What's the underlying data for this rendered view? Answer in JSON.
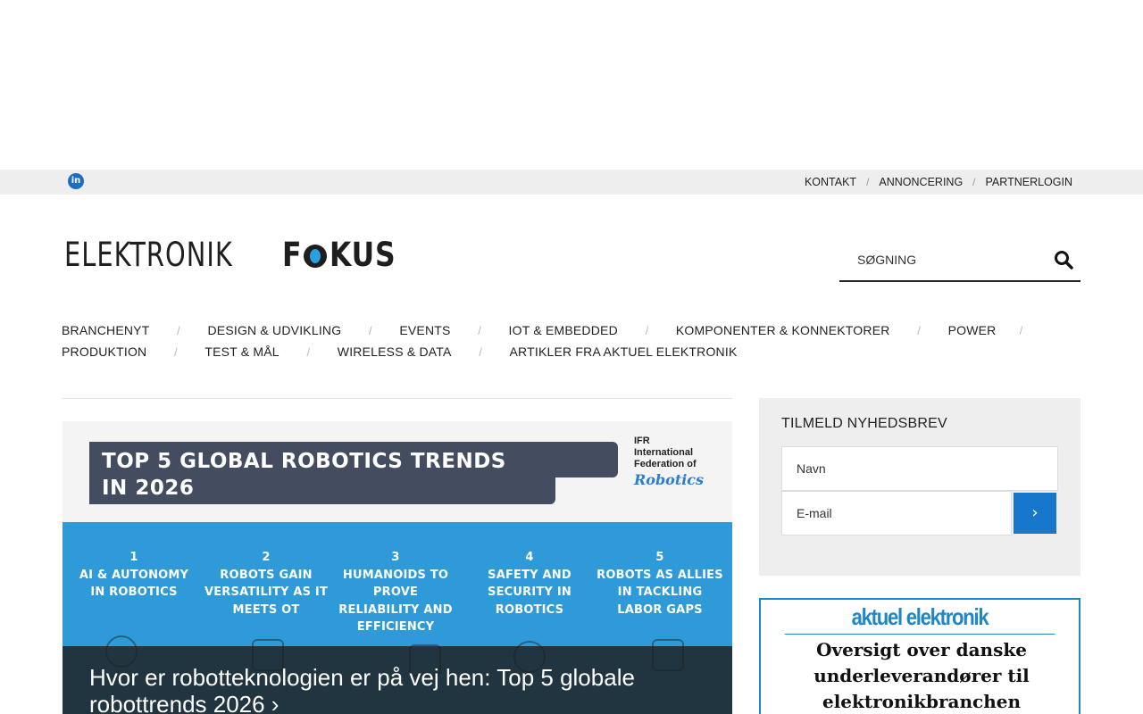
{
  "topbar": {
    "social_icon": "linkedin-icon",
    "social_label": "in",
    "links": [
      "KONTAKT",
      "ANNONCERING",
      "PARTNERLOGIN"
    ],
    "separator": "/"
  },
  "logo": {
    "part1": "ELEKTRONIK",
    "part2_prefix": "F",
    "part2_suffix": "KUS"
  },
  "search": {
    "placeholder": "SØGNING",
    "icon": "search-icon"
  },
  "nav": {
    "row1": [
      "BRANCHENYT",
      "DESIGN & UDVIKLING",
      "EVENTS",
      "IOT & EMBEDDED",
      "KOMPONENTER & KONNEKTORER",
      "POWER"
    ],
    "row2": [
      "PRODUKTION",
      "TEST & MÅL",
      "WIRELESS & DATA",
      "ARTIKLER FRA AKTUEL ELEKTRONIK"
    ],
    "separator": "/"
  },
  "hero": {
    "banner_title_line1": "TOP 5 GLOBAL ROBOTICS TRENDS",
    "banner_title_line2": "IN 2026",
    "ifr_line1": "IFR",
    "ifr_line2": "International",
    "ifr_line3": "Federation of",
    "ifr_line4": "Robotics",
    "trends": [
      {
        "num": "1",
        "line1": "AI & AUTONOMY",
        "line2": "IN ROBOTICS",
        "line3": "",
        "line4": ""
      },
      {
        "num": "2",
        "line1": "ROBOTS GAIN",
        "line2": "VERSATILITY AS IT",
        "line3": "MEETS OT",
        "line4": ""
      },
      {
        "num": "3",
        "line1": "HUMANOIDS TO",
        "line2": "PROVE",
        "line3": "RELIABILITY AND",
        "line4": "EFFICIENCY"
      },
      {
        "num": "4",
        "line1": "SAFETY AND",
        "line2": "SECURITY IN",
        "line3": "ROBOTICS",
        "line4": ""
      },
      {
        "num": "5",
        "line1": "ROBOTS AS ALLIES",
        "line2": "IN TACKLING",
        "line3": "LABOR GAPS",
        "line4": ""
      }
    ],
    "caption": "Hvor er robotteknologien er på vej hen: Top 5 globale robottrends 2026  ›"
  },
  "newsletter": {
    "title": "TILMELD NYHEDSBREV",
    "name_placeholder": "Navn",
    "email_placeholder": "E-mail",
    "submit_label": "›"
  },
  "ad": {
    "logo_text": "aktuel elektronik",
    "line1": "Oversigt over danske",
    "line2": "underleverandører til",
    "line3": "elektronikbranchen"
  },
  "colors": {
    "accent_blue": "#1777cc",
    "topbar_bg": "#eeeeee",
    "hero_blue": "#2e9bd8",
    "banner_dark": "#444d60"
  }
}
